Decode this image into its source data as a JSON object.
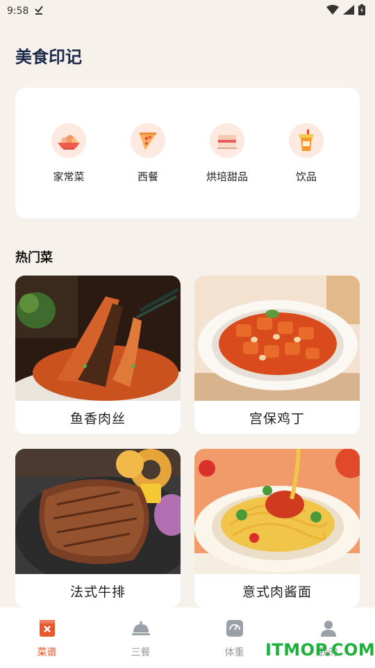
{
  "status": {
    "time": "9:58"
  },
  "app": {
    "title": "美食印记"
  },
  "categories": [
    {
      "label": "家常菜",
      "icon": "home-dish-icon"
    },
    {
      "label": "西餐",
      "icon": "pizza-icon"
    },
    {
      "label": "烘培甜品",
      "icon": "cake-icon"
    },
    {
      "label": "饮品",
      "icon": "drink-icon"
    }
  ],
  "hot": {
    "title": "热门菜",
    "dishes": [
      {
        "name": "鱼香肉丝"
      },
      {
        "name": "宫保鸡丁"
      },
      {
        "name": "法式牛排"
      },
      {
        "name": "意式肉酱面"
      }
    ]
  },
  "nav": [
    {
      "label": "菜谱",
      "icon": "recipe-icon",
      "active": true
    },
    {
      "label": "三餐",
      "icon": "cloche-icon",
      "active": false
    },
    {
      "label": "体重",
      "icon": "scale-icon",
      "active": false
    },
    {
      "label": "我的",
      "icon": "user-icon",
      "active": false
    }
  ],
  "colors": {
    "accent": "#e8572e",
    "inactive": "#999999",
    "title": "#1c2a4a"
  },
  "watermark": {
    "text": "ITMOP.COM"
  }
}
